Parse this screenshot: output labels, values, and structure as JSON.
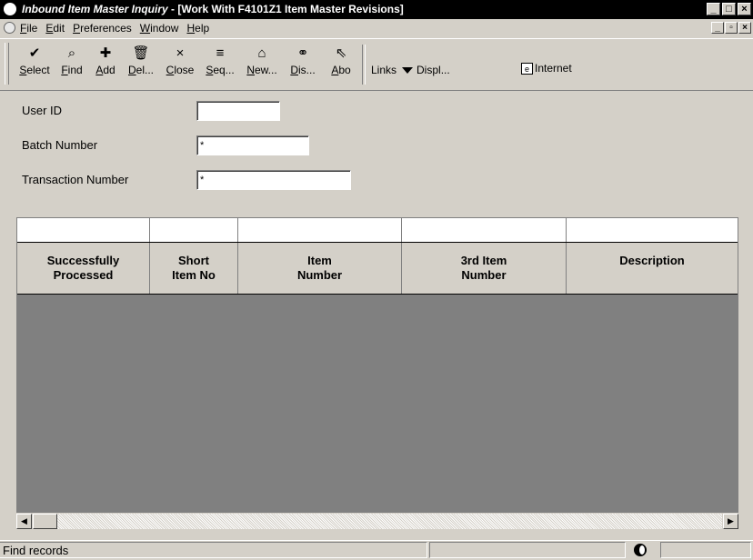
{
  "window": {
    "title_app": "Inbound Item Master Inquiry",
    "title_rest": " - [Work With F4101Z1 Item Master Revisions]",
    "controls": [
      "_",
      "□",
      "×"
    ],
    "mdi_controls": [
      "_",
      "▫",
      "×"
    ]
  },
  "menu": [
    "File",
    "Edit",
    "Preferences",
    "Window",
    "Help"
  ],
  "toolbar": {
    "buttons": [
      {
        "label": "Select",
        "icon": "✔",
        "icon_name": "checkmark-icon"
      },
      {
        "label": "Find",
        "icon": "⌕",
        "icon_name": "find-icon"
      },
      {
        "label": "Add",
        "icon": "✚",
        "icon_name": "add-icon"
      },
      {
        "label": "Del...",
        "icon": "🗑",
        "icon_name": "trash-icon"
      },
      {
        "label": "Close",
        "icon": "×",
        "icon_name": "close-icon"
      },
      {
        "label": "Seq...",
        "icon": "≡",
        "icon_name": "sequence-icon"
      },
      {
        "label": "New...",
        "icon": "⌂",
        "icon_name": "new-icon"
      },
      {
        "label": "Dis...",
        "icon": "⚭",
        "icon_name": "display-icon"
      },
      {
        "label": "Abo",
        "icon": "⇖",
        "icon_name": "about-icon"
      }
    ],
    "links_label": "Links",
    "display_label": "Displ...",
    "internet_label": "Internet"
  },
  "form": {
    "user_id_label": "User ID",
    "user_id_value": "",
    "batch_label": "Batch Number",
    "batch_value": "*",
    "transaction_label": "Transaction Number",
    "transaction_value": "*"
  },
  "grid": {
    "columns": [
      {
        "line1": "Successfully",
        "line2": "Processed"
      },
      {
        "line1": "Short",
        "line2": "Item No"
      },
      {
        "line1": "Item",
        "line2": "Number"
      },
      {
        "line1": "3rd Item",
        "line2": "Number"
      },
      {
        "line1": "Description",
        "line2": ""
      }
    ],
    "rows": []
  },
  "status": {
    "text": "Find records"
  }
}
